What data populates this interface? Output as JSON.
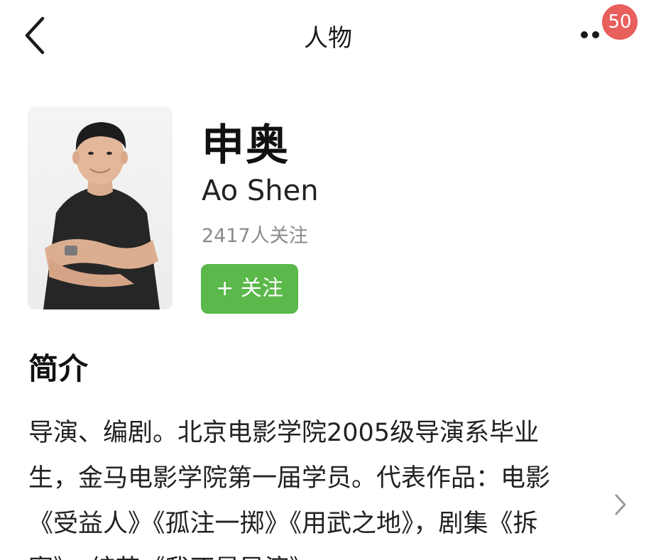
{
  "header": {
    "title": "人物",
    "badge_count": "50",
    "back_icon": "chevron-left-icon",
    "more_icon": "more-dots-icon"
  },
  "profile": {
    "name": "申奥",
    "english_name": "Ao Shen",
    "followers": "2417人关注",
    "follow_button": "+ 关注",
    "follow_button_color": "#5bb84a"
  },
  "intro": {
    "title": "简介",
    "text": "导演、编剧。北京电影学院2005级导演系毕业生，金马电影学院第一届学员。代表作品：电影《受益人》《孤注一掷》《用武之地》，剧集《拆案》，综艺《我不是导演》",
    "expand_icon": "chevron-right-icon"
  },
  "colors": {
    "badge": "#e85f5c",
    "accent": "#5bb84a",
    "muted_text": "#8a8a8a"
  }
}
